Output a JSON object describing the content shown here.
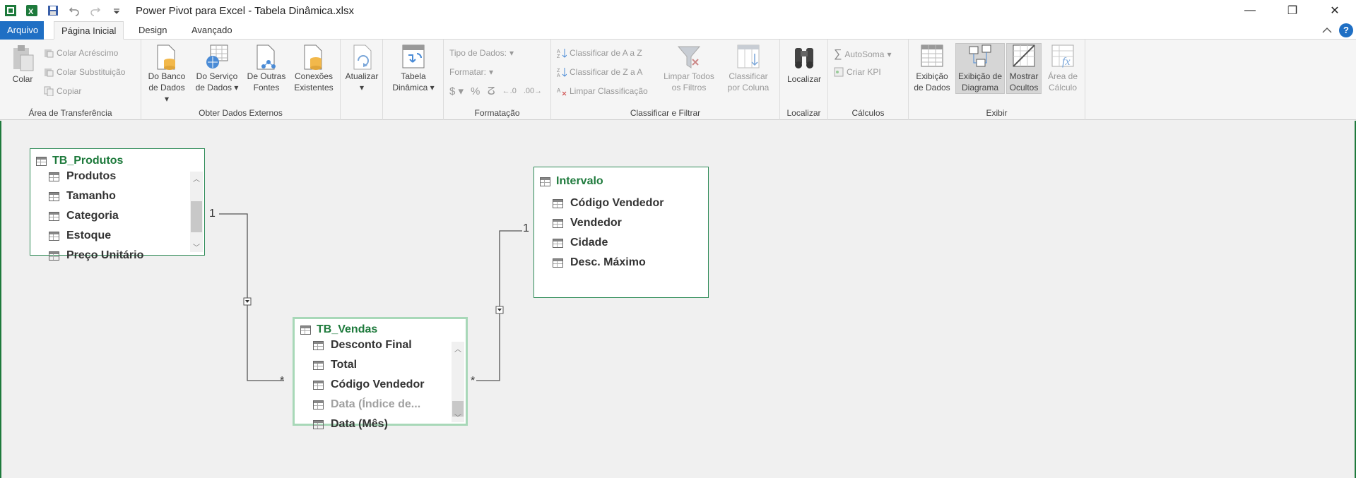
{
  "window": {
    "title": "Power Pivot para Excel - Tabela Dinâmica.xlsx",
    "minimize": "—",
    "restore": "❐",
    "close": "✕"
  },
  "tabs": {
    "file": "Arquivo",
    "home": "Página Inicial",
    "design": "Design",
    "advanced": "Avançado",
    "help": "?"
  },
  "ribbon": {
    "clipboard": {
      "group": "Área de Transferência",
      "paste": "Colar",
      "paste_append": "Colar Acréscimo",
      "paste_replace": "Colar Substituição",
      "copy": "Copiar"
    },
    "external": {
      "group": "Obter Dados Externos",
      "from_db_1": "Do Banco",
      "from_db_2": "de Dados",
      "from_service_1": "Do Serviço",
      "from_service_2": "de Dados",
      "other_sources_1": "De Outras",
      "other_sources_2": "Fontes",
      "existing_1": "Conexões",
      "existing_2": "Existentes"
    },
    "refresh": {
      "label": "Atualizar"
    },
    "pivot": {
      "label_1": "Tabela",
      "label_2": "Dinâmica"
    },
    "formatting": {
      "group": "Formatação",
      "data_type": "Tipo de Dados:",
      "format": "Formatar:"
    },
    "sort": {
      "group": "Classificar e Filtrar",
      "sort_az": "Classificar de A a Z",
      "sort_za": "Classificar de Z a A",
      "clear_sort": "Limpar Classificação",
      "clear_filters_1": "Limpar Todos",
      "clear_filters_2": "os Filtros",
      "sort_by_col_1": "Classificar",
      "sort_by_col_2": "por Coluna"
    },
    "find": {
      "group": "Localizar",
      "label": "Localizar"
    },
    "calc": {
      "group": "Cálculos",
      "autosum": "AutoSoma",
      "kpi": "Criar KPI"
    },
    "view": {
      "group": "Exibir",
      "data_view_1": "Exibição",
      "data_view_2": "de Dados",
      "diagram_view_1": "Exibição de",
      "diagram_view_2": "Diagrama",
      "show_hidden_1": "Mostrar",
      "show_hidden_2": "Ocultos",
      "calc_area_1": "Área de",
      "calc_area_2": "Cálculo"
    }
  },
  "diagram": {
    "tables": [
      {
        "name": "TB_Produtos",
        "columns": [
          "Produtos",
          "Tamanho",
          "Categoria",
          "Estoque",
          "Preço Unitário"
        ]
      },
      {
        "name": "Intervalo",
        "columns": [
          "Código Vendedor",
          "Vendedor",
          "Cidade",
          "Desc. Máximo"
        ]
      },
      {
        "name": "TB_Vendas",
        "columns": [
          "Desconto Final",
          "Total",
          "Código Vendedor",
          "Data (Índice de...",
          "Data (Mês)"
        ]
      }
    ],
    "relationship_labels": {
      "one": "1",
      "many": "*"
    }
  }
}
